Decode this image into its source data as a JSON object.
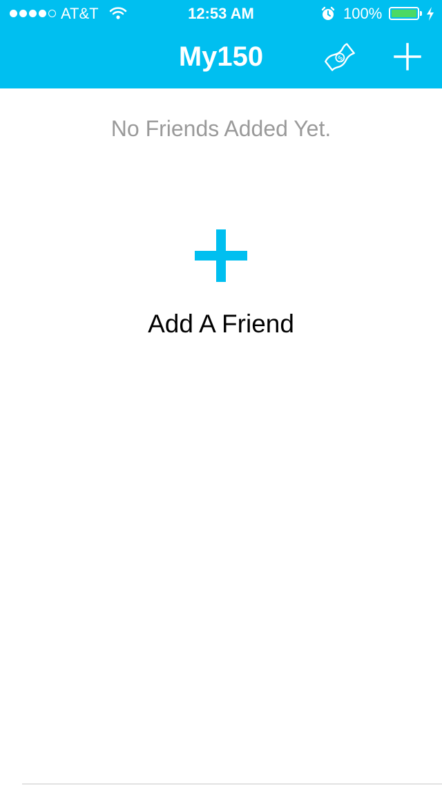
{
  "status_bar": {
    "signal_bars_filled": 4,
    "signal_bars_total": 5,
    "carrier": "AT&T",
    "time": "12:53 AM",
    "battery_percent": "100%",
    "battery_level": 1.0,
    "icons": [
      "wifi-icon",
      "alarm-icon",
      "battery-icon",
      "charging-bolt-icon"
    ]
  },
  "nav": {
    "title": "My150",
    "icons": [
      "money-bill-icon",
      "plus-icon"
    ]
  },
  "content": {
    "empty_message": "No Friends Added Yet.",
    "add_friend_label": "Add A Friend",
    "add_friend_icon": "plus-icon"
  },
  "colors": {
    "accent": "#00bff0",
    "battery_fill": "#4cd964",
    "muted_text": "#9a9a9a"
  }
}
